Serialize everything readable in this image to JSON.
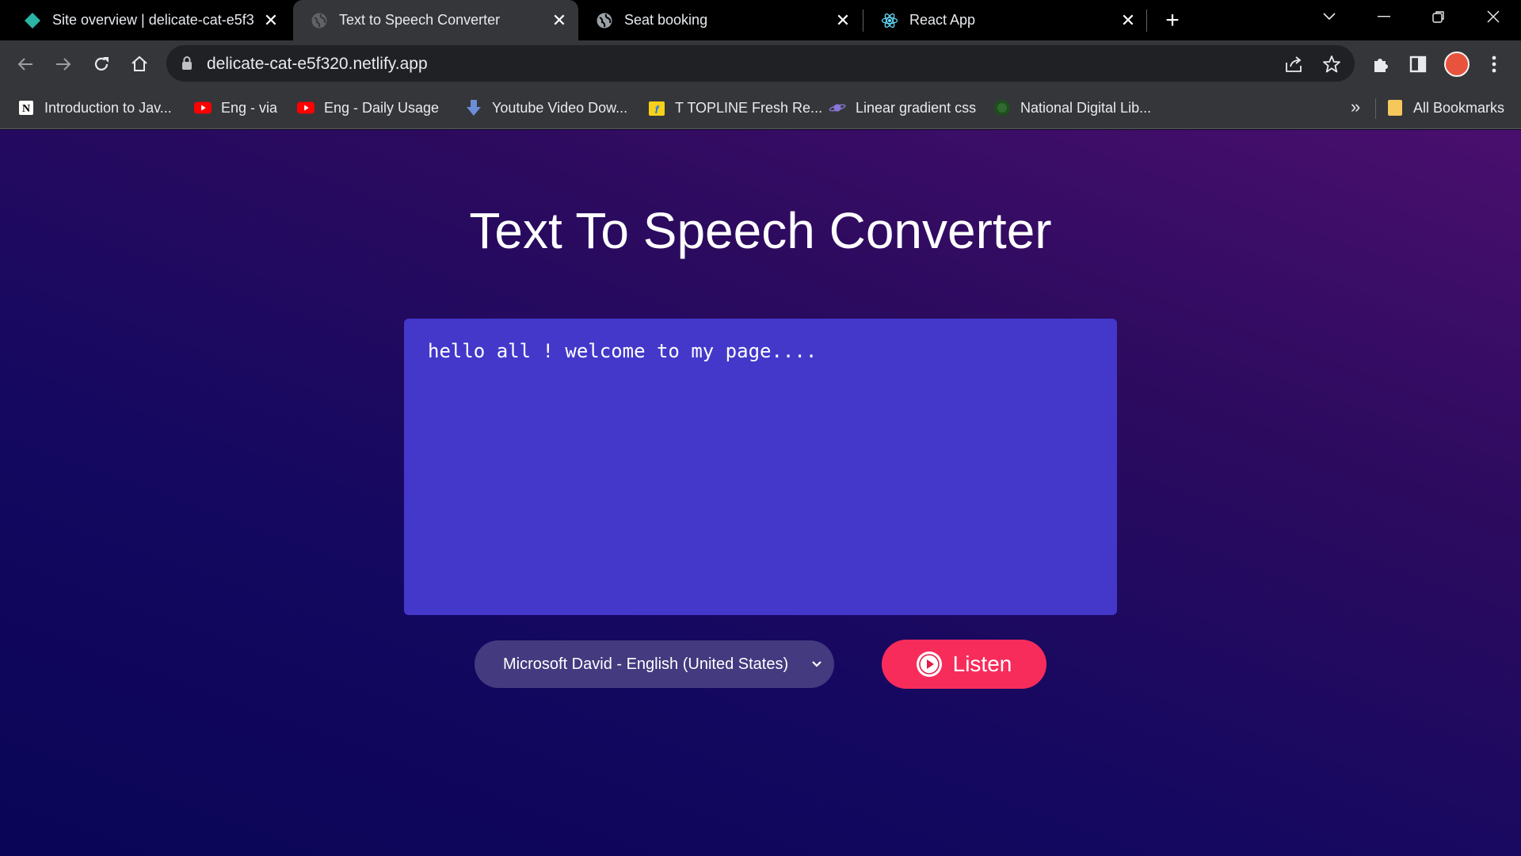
{
  "browser": {
    "tabs": [
      {
        "title": "Site overview | delicate-cat-e5f3",
        "favicon": "netlify-diamond-icon",
        "active": false
      },
      {
        "title": "Text to Speech Converter",
        "favicon": "globe-icon",
        "active": true
      },
      {
        "title": "Seat booking",
        "favicon": "globe-icon",
        "active": false
      },
      {
        "title": "React App",
        "favicon": "react-atom-icon",
        "active": false
      }
    ],
    "new_tab_symbol": "+",
    "address": "delicate-cat-e5f320.netlify.app",
    "bookmarks": [
      {
        "label": "Introduction to Jav...",
        "icon": "notion-icon"
      },
      {
        "label": "Eng - via",
        "icon": "youtube-icon"
      },
      {
        "label": "Eng -  Daily Usage",
        "icon": "youtube-icon"
      },
      {
        "label": "Youtube Video Dow...",
        "icon": "download-arrow-icon"
      },
      {
        "label": "T TOPLINE Fresh Re...",
        "icon": "flipkart-icon"
      },
      {
        "label": "Linear gradient css",
        "icon": "planet-icon"
      },
      {
        "label": "National Digital Lib...",
        "icon": "ndl-icon"
      }
    ],
    "bookmarks_overflow": "»",
    "all_bookmarks_label": "All Bookmarks"
  },
  "app": {
    "title": "Text To Speech Converter",
    "textarea_value": "hello all ! welcome to my page....",
    "voice_selected": "Microsoft David - English (United States)",
    "listen_label": "Listen",
    "accent_color": "#f72c5b",
    "textarea_color": "#4338ca"
  }
}
